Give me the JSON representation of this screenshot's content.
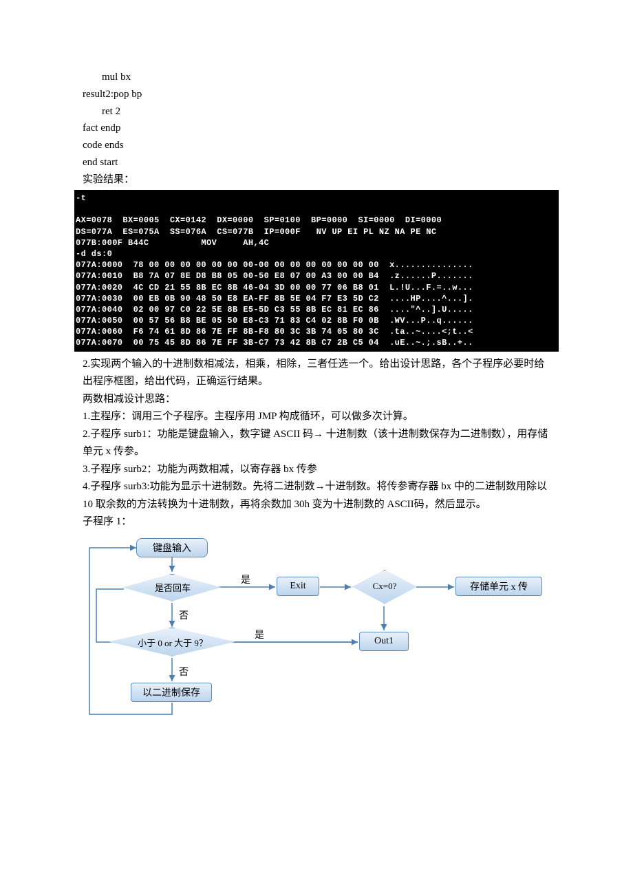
{
  "code_lines": [
    {
      "indent": true,
      "text": "mul bx"
    },
    {
      "indent": false,
      "text": "result2:pop bp"
    },
    {
      "indent": true,
      "text": "ret 2"
    },
    {
      "indent": false,
      "text": "fact endp"
    },
    {
      "indent": false,
      "text": "code ends"
    },
    {
      "indent": false,
      "text": "end start"
    }
  ],
  "result_label": "实验结果：",
  "terminal": "-t\n\nAX=0078  BX=0005  CX=0142  DX=0000  SP=0100  BP=0000  SI=0000  DI=0000\nDS=077A  ES=075A  SS=076A  CS=077B  IP=000F   NV UP EI PL NZ NA PE NC\n077B:000F B44C          MOV     AH,4C\n-d ds:0\n077A:0000  78 00 00 00 00 00 00 00-00 00 00 00 00 00 00 00  x...............\n077A:0010  B8 7A 07 8E D8 B8 05 00-50 E8 07 00 A3 00 00 B4  .z......P.......\n077A:0020  4C CD 21 55 8B EC 8B 46-04 3D 00 00 77 06 B8 01  L.!U...F.=..w...\n077A:0030  00 EB 0B 90 48 50 E8 EA-FF 8B 5E 04 F7 E3 5D C2  ....HP....^...].\n077A:0040  02 00 97 C0 22 5E 8B E5-5D C3 55 8B EC 81 EC 86  ....\"^..].U.....\n077A:0050  00 57 56 B8 BE 05 50 E8-C3 71 83 C4 02 8B F0 0B  .WV...P..q......\n077A:0060  F6 74 61 8D 86 7E FF 8B-F8 80 3C 3B 74 05 80 3C  .ta..~....<;t..<\n077A:0070  00 75 45 8D 86 7E FF 3B-C7 73 42 8B C7 2B C5 04  .uE..~.;.sB..+..",
  "section2_title": "2.实现两个输入的十进制数相减法，相乘，相除，三者任选一个。给出设计思路，各个子程序必要时给出程序框图，给出代码，正确运行结果。",
  "design_label": "两数相减设计思路：",
  "steps": [
    "1.主程序：调用三个子程序。主程序用 JMP 构成循环，可以做多次计算。",
    "2.子程序 surb1：功能是键盘输入，数字键 ASCII 码→ 十进制数（该十进制数保存为二进制数），用存储单元 x 传参。",
    "3.子程序 surb2：功能为两数相减，以寄存器 bx 传参",
    "4.子程序 surb3:功能为显示十进制数。先将二进制数→十进制数。将传参寄存器 bx 中的二进制数用除以 10   取余数的方法转换为十进制数，再将余数加 30h 变为十进制数的 ASCII码，然后显示。"
  ],
  "sub1_label": "子程序 1：",
  "chart_data": {
    "type": "flowchart",
    "nodes": [
      {
        "id": "input",
        "kind": "terminator",
        "label": "键盘输入"
      },
      {
        "id": "is_enter",
        "kind": "decision",
        "label": "是否回车"
      },
      {
        "id": "range",
        "kind": "decision",
        "label": "小于 0 or 大于 9？"
      },
      {
        "id": "save",
        "kind": "process",
        "label": "以二进制保存"
      },
      {
        "id": "exit",
        "kind": "process",
        "label": "Exit"
      },
      {
        "id": "cx0",
        "kind": "decision",
        "label": "Cx=0?"
      },
      {
        "id": "out1",
        "kind": "process",
        "label": "Out1"
      },
      {
        "id": "store_x",
        "kind": "process",
        "label": "存储单元 x 传"
      }
    ],
    "edges": [
      {
        "from": "input",
        "to": "is_enter"
      },
      {
        "from": "is_enter",
        "to": "exit",
        "label": "是"
      },
      {
        "from": "is_enter",
        "to": "range",
        "label": "否"
      },
      {
        "from": "range",
        "to": "out1",
        "label": "是"
      },
      {
        "from": "range",
        "to": "save",
        "label": "否"
      },
      {
        "from": "save",
        "to": "input",
        "label": "(loop left)"
      },
      {
        "from": "exit",
        "to": "cx0"
      },
      {
        "from": "cx0",
        "to": "store_x"
      },
      {
        "from": "cx0",
        "to": "out1"
      },
      {
        "from": "out1",
        "to": "input",
        "label": "(loop left)"
      }
    ]
  },
  "fc_labels": {
    "input": "键盘输入",
    "is_enter": "是否回车",
    "range": "小于 0 or 大于 9？",
    "save": "以二进制保存",
    "exit": "Exit",
    "cx0": "Cx=0?",
    "out1": "Out1",
    "store_x": "存储单元 x 传",
    "yes": "是",
    "no": "否"
  }
}
